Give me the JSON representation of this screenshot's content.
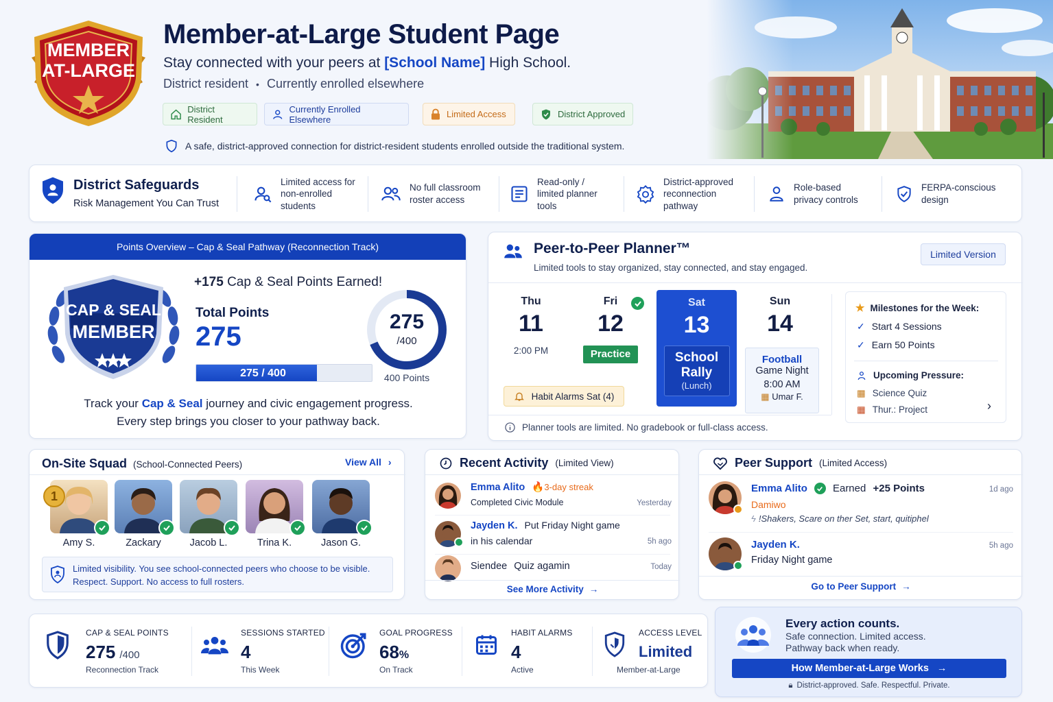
{
  "header": {
    "badge_line1": "MEMBER",
    "badge_line2": "AT-LARGE",
    "title": "Member-at-Large Student Page",
    "subtitle_prefix": "Stay connected with your peers at ",
    "school_name": "[School Name]",
    "subtitle_suffix": " High School.",
    "status_line_a": "District resident",
    "status_sep": "•",
    "status_line_b": "Currently enrolled elsewhere",
    "pills": [
      {
        "label": "District Resident",
        "icon": "home-icon",
        "color": "#2e8b4a"
      },
      {
        "label": "Currently Enrolled Elsewhere",
        "icon": "user-icon",
        "color": "#1546c4"
      },
      {
        "label": "Limited Access",
        "icon": "lock-icon",
        "color": "#d9822b"
      },
      {
        "label": "District Approved",
        "icon": "shield-check-icon",
        "color": "#2e8b4a"
      }
    ],
    "note": "A safe, district-approved connection for district-resident students enrolled outside the traditional system."
  },
  "safeguards": {
    "title": "District Safeguards",
    "subtitle": "Risk Management You Can Trust",
    "items": [
      {
        "icon": "user-search-icon",
        "label": "Limited access for non-enrolled students"
      },
      {
        "icon": "users-icon",
        "label": "No full classroom roster access"
      },
      {
        "icon": "checklist-icon",
        "label": "Read-only / limited planner tools"
      },
      {
        "icon": "badge-cog-icon",
        "label": "District-approved reconnection pathway"
      },
      {
        "icon": "user-lock-icon",
        "label": "Role-based privacy controls"
      },
      {
        "icon": "shield-check-icon",
        "label": "FERPA-conscious design"
      }
    ]
  },
  "points": {
    "header": "Points Overview – Cap & Seal Pathway (Reconnection Track)",
    "crest_line1": "CAP & SEAL",
    "crest_line2": "MEMBER",
    "earned_amount": "+175",
    "earned_text": " Cap & Seal Points Earned!",
    "total_label": "Total Points",
    "total_value": "275",
    "bar_text": "275 / 400",
    "progress_fraction": 0.6875,
    "ring_value": "275",
    "ring_max": "/400",
    "ring_caption": "400 Points",
    "track_prefix": "Track your ",
    "track_highlight": "Cap & Seal",
    "track_suffix": " journey and civic engagement progress.",
    "track_line2": "Every step brings you closer to your pathway back."
  },
  "planner": {
    "title": "Peer-to-Peer Planner™",
    "subtitle": "Limited tools to stay organized, stay connected, and stay engaged.",
    "version_button": "Limited Version",
    "days": [
      {
        "name": "Thu",
        "num": "11",
        "detail": "2:00 PM"
      },
      {
        "name": "Fri",
        "num": "12",
        "tag": "Practice"
      },
      {
        "name": "Sat",
        "num": "13",
        "event_line1": "School",
        "event_line2": "Rally",
        "event_line3": "(Lunch)"
      },
      {
        "name": "Sun",
        "num": "14",
        "event_line1": "Football",
        "event_line2": "Game Night",
        "time": "8:00 AM",
        "person": "Umar F."
      }
    ],
    "alarm": "Habit Alarms Sat (4)",
    "footer": "Planner tools are limited. No gradebook or full-class access.",
    "milestones_title": "Milestones for the Week:",
    "milestones": [
      "Start 4 Sessions",
      "Earn 50 Points"
    ],
    "pressure_title": "Upcoming Pressure:",
    "pressure": [
      "Science Quiz",
      "Thur.: Project"
    ]
  },
  "squad": {
    "title": "On-Site Squad",
    "qualifier": "(School-Connected Peers)",
    "view_all": "View All",
    "rank_badge": "1",
    "members": [
      {
        "name": "Amy S.",
        "bg": "#e9c9a0"
      },
      {
        "name": "Zackary",
        "bg": "#7aa3d6"
      },
      {
        "name": "Jacob L.",
        "bg": "#9fb7cf"
      },
      {
        "name": "Trina K.",
        "bg": "#b89fc9"
      },
      {
        "name": "Jason G.",
        "bg": "#6f8fbf"
      }
    ],
    "note_line1": "Limited visibility. You see school-connected peers who choose to be visible.",
    "note_line2": "Respect. Support. No access to full rosters."
  },
  "activity": {
    "title": "Recent Activity",
    "qualifier": "(Limited View)",
    "rows": [
      {
        "name": "Emma Alito",
        "streak": "3-day streak",
        "text": "Completed Civic Module",
        "time": "Yesterday"
      },
      {
        "name": "Jayden K.",
        "text_a": "Put Friday Night game",
        "text_b": "in his calendar",
        "time": "5h ago"
      },
      {
        "name": "Siendee",
        "text": "Quiz agamin",
        "time": "Today"
      }
    ],
    "see_more": "See More Activity"
  },
  "peer": {
    "title": "Peer Support",
    "qualifier": "(Limited Access)",
    "rows": [
      {
        "name": "Emma Alito",
        "earned": "Earned ",
        "points": "+25 Points",
        "sub": "Damiwo",
        "quote": "!Shakers, Scare on ther Set, start, quitiphel",
        "time": "1d ago"
      },
      {
        "name": "Jayden K.",
        "text": "Friday Night game",
        "time": "5h ago"
      }
    ],
    "link": "Go to Peer Support"
  },
  "stats": [
    {
      "label": "CAP & SEAL POINTS",
      "value": "275",
      "suffix": "/400",
      "sub": "Reconnection Track",
      "icon": "shield-icon"
    },
    {
      "label": "SESSIONS STARTED",
      "value": "4",
      "suffix": "",
      "sub": "This Week",
      "icon": "group-icon"
    },
    {
      "label": "GOAL PROGRESS",
      "value": "68",
      "suffix": "%",
      "sub": "On Track",
      "icon": "target-icon"
    },
    {
      "label": "HABIT ALARMS",
      "value": "4",
      "suffix": "",
      "sub": "Active",
      "icon": "calendar-icon"
    },
    {
      "label": "ACCESS LEVEL",
      "value": "Limited",
      "suffix": "",
      "sub": "Member-at-Large",
      "icon": "shield-half-icon"
    }
  ],
  "cta": {
    "title": "Every action counts.",
    "line1": "Safe connection. Limited access.",
    "line2": "Pathway back when ready.",
    "button": "How Member-at-Large Works",
    "footer": "District-approved. Safe. Respectful. Private."
  }
}
